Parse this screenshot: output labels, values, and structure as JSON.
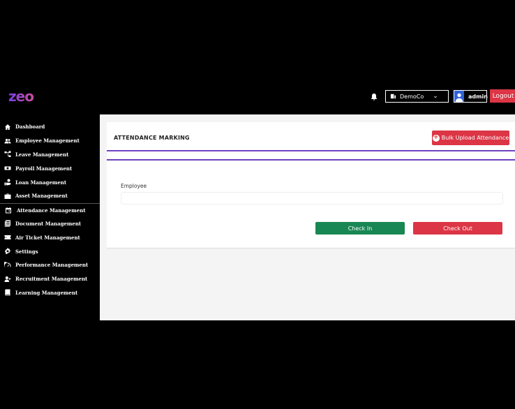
{
  "header": {
    "logo_text": "zeo",
    "company": "DemoCo",
    "user": "admin",
    "logout_label": "Logout",
    "icons": [
      "bell-icon",
      "building-icon",
      "chevron-down-icon",
      "user-avatar-icon"
    ]
  },
  "sidebar": {
    "items": [
      {
        "label": "Dashboard",
        "icon": "home-icon"
      },
      {
        "label": "Employee Management",
        "icon": "users-icon"
      },
      {
        "label": "Leave Management",
        "icon": "sitemap-icon"
      },
      {
        "label": "Payroll Management",
        "icon": "money-icon"
      },
      {
        "label": "Loan Management",
        "icon": "hand-money-icon"
      },
      {
        "label": "Asset Management",
        "icon": "briefcase-icon"
      },
      {
        "label": "Attendance Management",
        "icon": "calendar-icon"
      },
      {
        "label": "Document Management",
        "icon": "document-icon"
      },
      {
        "label": "Air Ticket Management",
        "icon": "ticket-icon"
      },
      {
        "label": "Settings",
        "icon": "gear-icon"
      },
      {
        "label": "Performance Management",
        "icon": "gauge-icon"
      },
      {
        "label": "Recruitment Management",
        "icon": "user-plus-icon"
      },
      {
        "label": "Learning Management",
        "icon": "book-icon"
      }
    ],
    "active": "Attendance Management"
  },
  "main": {
    "title": "ATTENDANCE MARKING",
    "bulk_upload_label": "Bulk Upload Attendance",
    "employee_label": "Employee",
    "employee_value": "",
    "checkin_label": "Check In",
    "checkout_label": "Check Out"
  },
  "colors": {
    "accent_purple": "#6f42c1",
    "danger": "#dc3545",
    "success": "#198754",
    "avatar_blue": "#2f62d7"
  }
}
